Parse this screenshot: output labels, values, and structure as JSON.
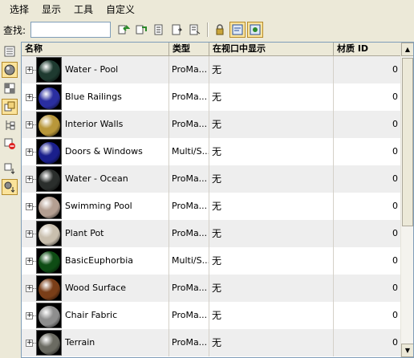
{
  "menu": [
    "选择",
    "显示",
    "工具",
    "自定义"
  ],
  "find": {
    "label": "查找:",
    "value": ""
  },
  "columns": {
    "name": "名称",
    "type": "类型",
    "viewport": "在视口中显示",
    "mat_id": "材质 ID"
  },
  "toolbar_icons": [
    "select-all-icon",
    "select-none-icon",
    "select-invert-icon",
    "select-children-icon",
    "select-dependents-icon",
    "lock-icon",
    "sync-selection-icon",
    "sync-scene-icon"
  ],
  "sidebar_icons": [
    "display-geometry-icon",
    "display-materials-icon",
    "display-maps-icon",
    "display-objects-icon",
    "display-subtree-icon",
    "display-missing-icon",
    "sort-icon",
    "sort-active-icon"
  ],
  "materials": [
    {
      "name": "Water - Pool",
      "type": "ProMa...",
      "viewport": "无",
      "mat_id": "0",
      "color": "#1e3a30"
    },
    {
      "name": "Blue Railings",
      "type": "ProMa...",
      "viewport": "无",
      "mat_id": "0",
      "color": "#2a2ea0"
    },
    {
      "name": "Interior Walls",
      "type": "ProMa...",
      "viewport": "无",
      "mat_id": "0",
      "color": "#b8973a"
    },
    {
      "name": "Doors & Windows",
      "type": "Multi/S...",
      "viewport": "无",
      "mat_id": "0",
      "color": "#1a1f8c"
    },
    {
      "name": "Water - Ocean",
      "type": "ProMa...",
      "viewport": "无",
      "mat_id": "0",
      "color": "#2a2e2c"
    },
    {
      "name": "Swimming Pool",
      "type": "ProMa...",
      "viewport": "无",
      "mat_id": "0",
      "color": "#b49f92"
    },
    {
      "name": "Plant Pot",
      "type": "ProMa...",
      "viewport": "无",
      "mat_id": "0",
      "color": "#c9bfae"
    },
    {
      "name": "BasicEuphorbia",
      "type": "Multi/S...",
      "viewport": "无",
      "mat_id": "0",
      "color": "#0e4c14"
    },
    {
      "name": "Wood Surface",
      "type": "ProMa...",
      "viewport": "无",
      "mat_id": "0",
      "color": "#7a3e18"
    },
    {
      "name": "Chair Fabric",
      "type": "ProMa...",
      "viewport": "无",
      "mat_id": "0",
      "color": "#8e8e8e"
    },
    {
      "name": "Terrain",
      "type": "ProMa...",
      "viewport": "无",
      "mat_id": "0",
      "color": "#6b6b62"
    }
  ]
}
